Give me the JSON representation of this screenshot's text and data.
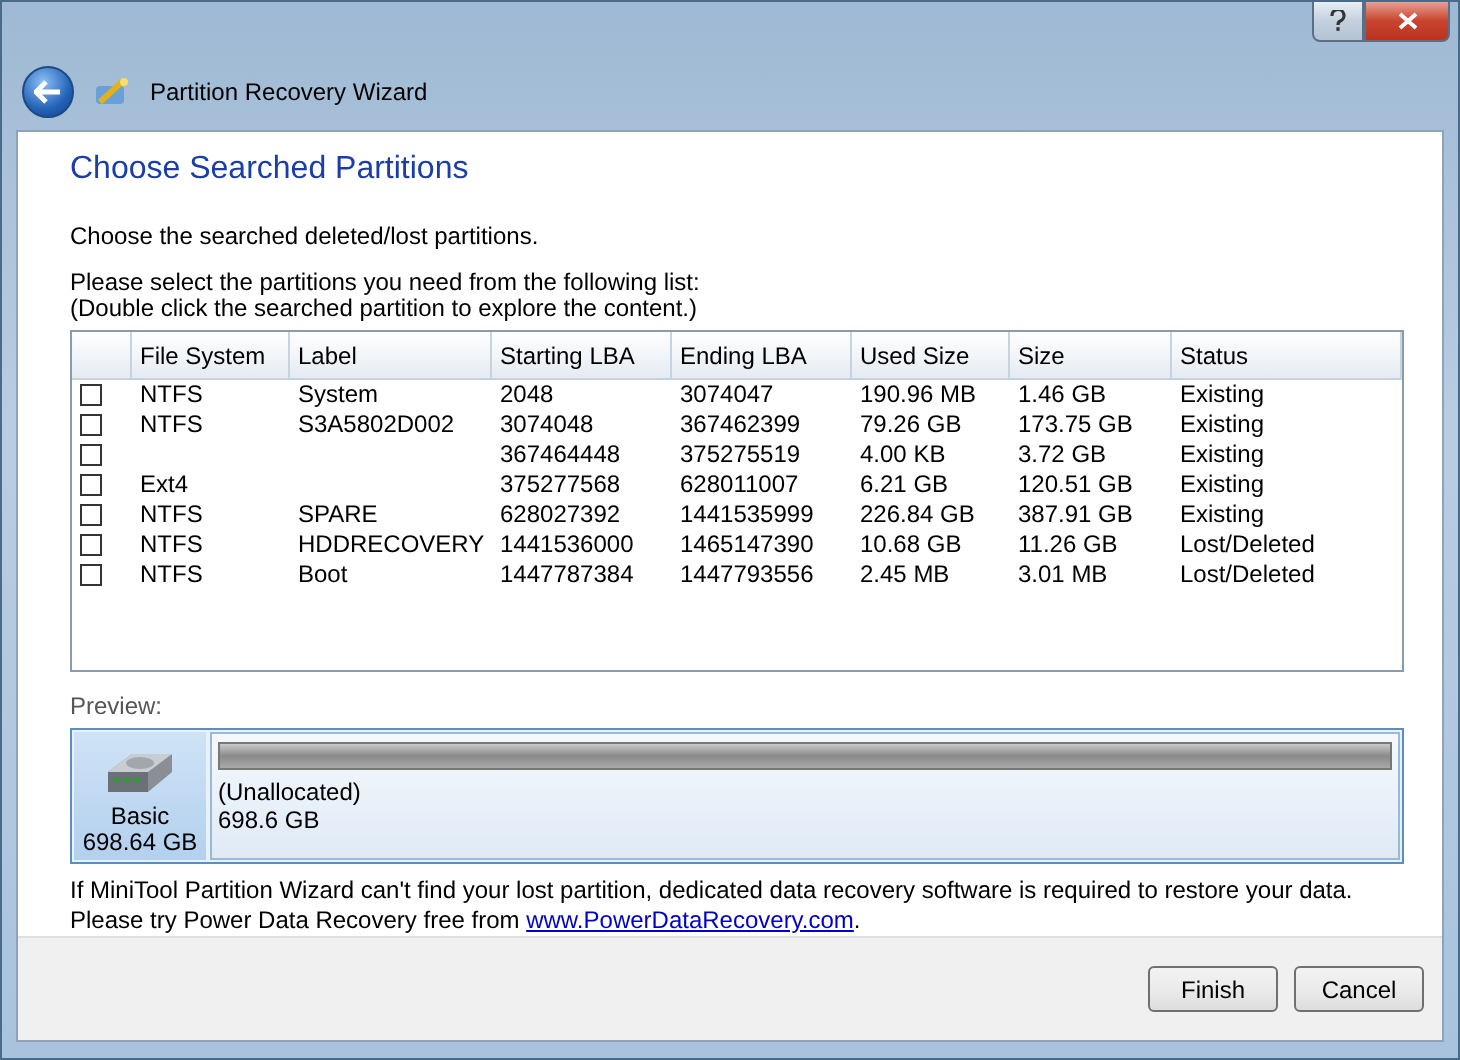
{
  "window": {
    "title": "Partition Recovery Wizard"
  },
  "heading": "Choose Searched Partitions",
  "intro": "Choose the searched deleted/lost partitions.",
  "instructions": [
    "Please select the partitions you need from the following list:",
    "(Double click the searched partition to explore the content.)"
  ],
  "table": {
    "columns": [
      "File System",
      "Label",
      "Starting LBA",
      "Ending LBA",
      "Used Size",
      "Size",
      "Status"
    ],
    "rows": [
      {
        "checked": false,
        "cells": [
          "NTFS",
          "System",
          "2048",
          "3074047",
          "190.96 MB",
          "1.46 GB",
          "Existing"
        ]
      },
      {
        "checked": false,
        "cells": [
          "NTFS",
          "S3A5802D002",
          "3074048",
          "367462399",
          "79.26 GB",
          "173.75 GB",
          "Existing"
        ]
      },
      {
        "checked": false,
        "cells": [
          "",
          "",
          "367464448",
          "375275519",
          "4.00 KB",
          "3.72 GB",
          "Existing"
        ]
      },
      {
        "checked": false,
        "cells": [
          "Ext4",
          "",
          "375277568",
          "628011007",
          "6.21 GB",
          "120.51 GB",
          "Existing"
        ]
      },
      {
        "checked": false,
        "cells": [
          "NTFS",
          "SPARE",
          "628027392",
          "1441535999",
          "226.84 GB",
          "387.91 GB",
          "Existing"
        ]
      },
      {
        "checked": false,
        "cells": [
          "NTFS",
          "HDDRECOVERY",
          "1441536000",
          "1465147390",
          "10.68 GB",
          "11.26 GB",
          "Lost/Deleted"
        ]
      },
      {
        "checked": false,
        "cells": [
          "NTFS",
          "Boot",
          "1447787384",
          "1447793556",
          "2.45 MB",
          "3.01 MB",
          "Lost/Deleted"
        ]
      }
    ]
  },
  "preview": {
    "label": "Preview:",
    "disk": {
      "type": "Basic",
      "size": "698.64 GB"
    },
    "partition": {
      "name": "(Unallocated)",
      "size": "698.6 GB"
    }
  },
  "note": {
    "text": "If MiniTool Partition Wizard can't find your lost partition, dedicated data recovery software is required to restore your data. Please try Power Data Recovery free from",
    "link": "www.PowerDataRecovery.com",
    "end": "."
  },
  "buttons": [
    "Finish",
    "Cancel"
  ]
}
